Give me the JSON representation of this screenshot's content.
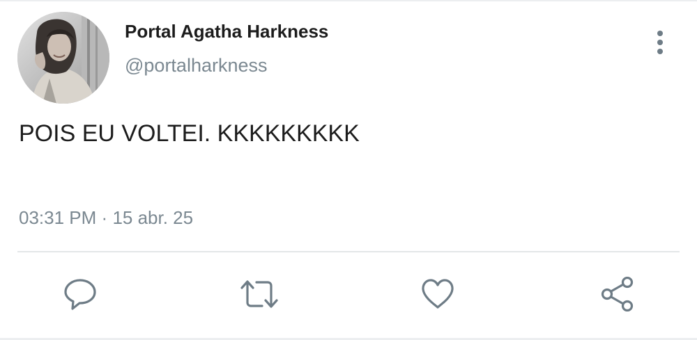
{
  "tweet": {
    "author": {
      "display_name": "Portal Agatha Harkness",
      "handle": "@portalharkness"
    },
    "text": "POIS EU VOLTEI. KKKKKKKKK",
    "time": "03:31 PM",
    "separator": "·",
    "date": "15 abr. 25"
  },
  "icons": {
    "more": "more-vertical-icon",
    "reply": "speech-bubble-icon",
    "retweet": "retweet-icon",
    "like": "heart-icon",
    "share": "share-icon"
  },
  "colors": {
    "text": "#1c1c1c",
    "secondary": "#7b8891",
    "icon": "#6e7c86",
    "divider": "#e3e6e8"
  }
}
